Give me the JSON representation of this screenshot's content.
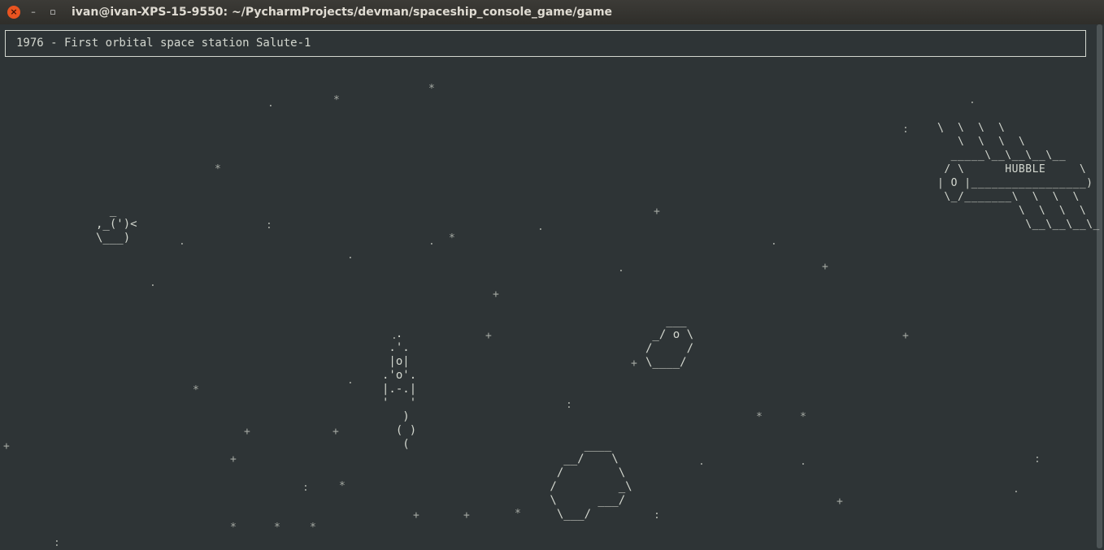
{
  "window": {
    "title": "ivan@ivan-XPS-15-9550: ~/PycharmProjects/devman/spaceship_console_game/game",
    "close_glyph": "×",
    "minimize_glyph": "–",
    "maximize_glyph": "▫"
  },
  "status_bar": {
    "text": "1976 - First orbital space station Salute-1"
  },
  "sprites": {
    "hubble": "\\  \\  \\  \\\n   \\  \\  \\  \\\n  _____\\__\\__\\__\\__\n / \\      HUBBLE     \\\n| O |_________________)\n \\_/_______\\  \\  \\  \\\n            \\  \\  \\  \\\n             \\__\\__\\__\\_",
    "salute": "  _\n,_(')<\n\\___)",
    "rocket": "  .\n .'.\n |o|\n.'o'.\n|.-.|\n'   '",
    "rocket_fire": "   )\n  ( )\n   (",
    "asteroid_small": "   ___\n _/ o \\\n/     /\n\\____/",
    "asteroid_big": "      ____\n   __/    \\\n  /        \\\n /         _\\\n \\      ___/\n  \\___/"
  },
  "stars": [
    "*",
    ".",
    "*",
    ".",
    ":",
    ".",
    "\\",
    "*",
    "+",
    ":",
    ".",
    ".",
    "*",
    ".",
    ".",
    "+",
    ".",
    ".",
    "+",
    ".",
    "+",
    ".",
    "+",
    "+",
    "*",
    ".",
    ":",
    "+",
    "*",
    "*",
    "+",
    "+",
    "+",
    "+",
    ".",
    ".",
    ":",
    "+",
    ":",
    "*",
    ".",
    ":",
    "+",
    "+",
    "*",
    ":",
    "*",
    "*",
    "*",
    ":"
  ]
}
